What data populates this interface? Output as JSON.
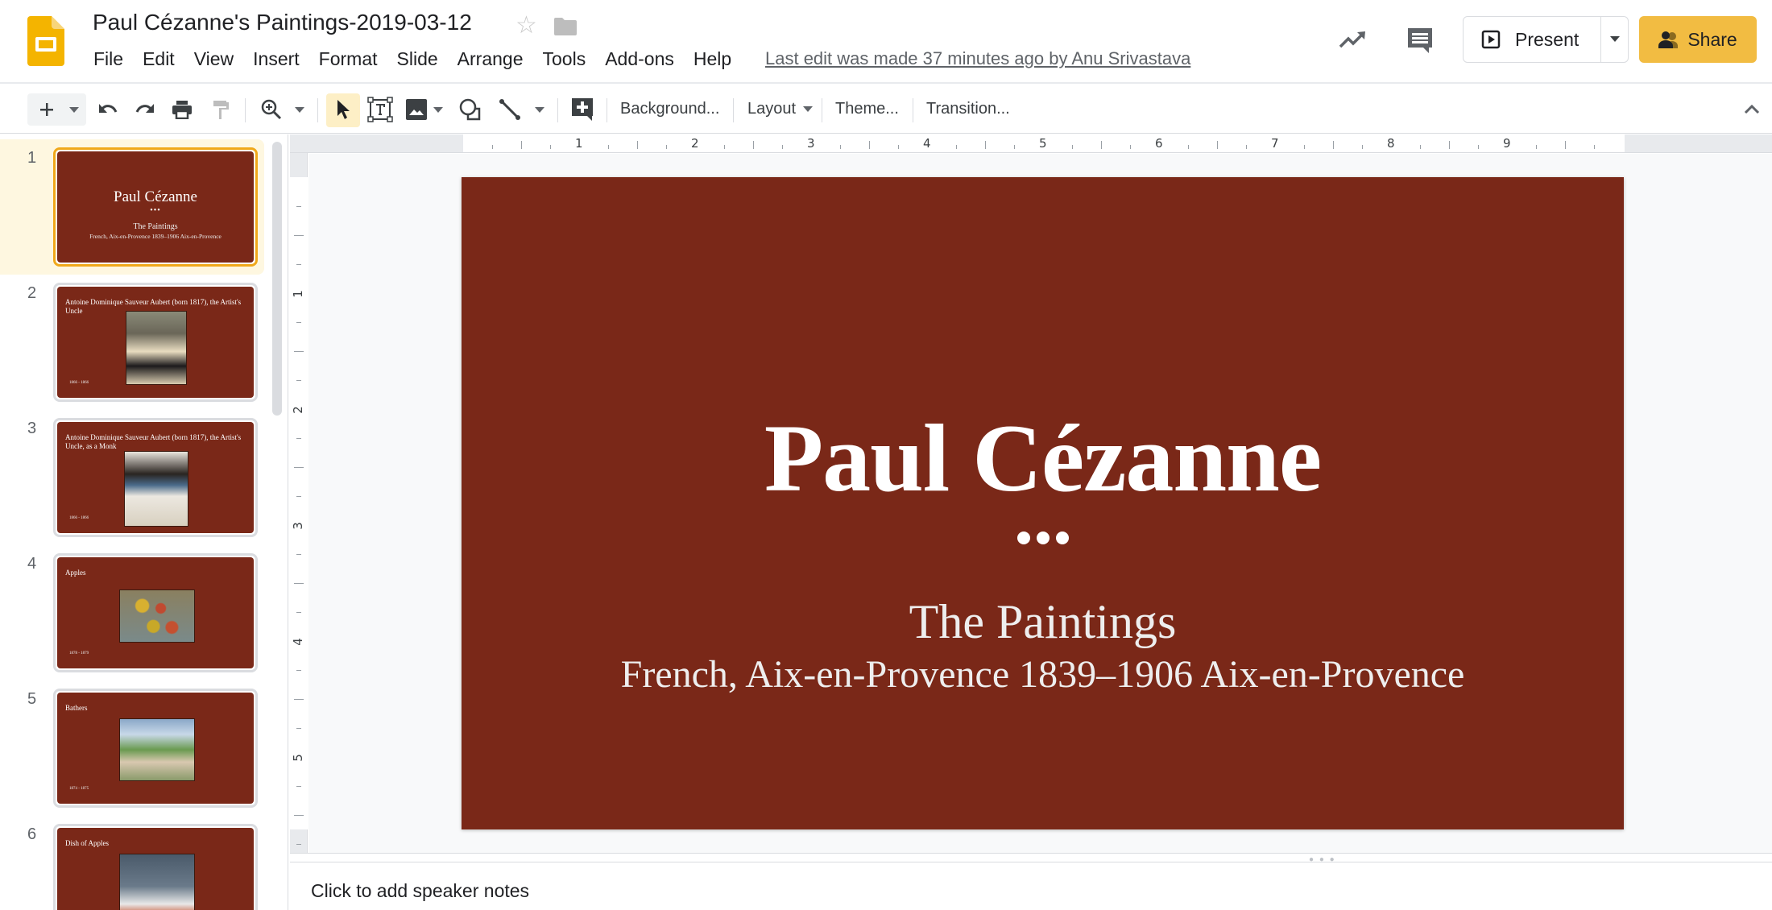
{
  "app": {
    "doc_title": "Paul Cézanne's Paintings-2019-03-12",
    "last_edit": "Last edit was made 37 minutes ago by Anu Srivastava",
    "icons": {
      "logo": "google-slides-logo",
      "star": "star-icon",
      "folder": "folder-icon",
      "activity": "activity-trend-icon",
      "comments": "comments-icon",
      "present": "present-play-icon",
      "share": "share-people-icon"
    }
  },
  "menu": [
    "File",
    "Edit",
    "View",
    "Insert",
    "Format",
    "Slide",
    "Arrange",
    "Tools",
    "Add-ons",
    "Help"
  ],
  "header_buttons": {
    "present": "Present",
    "share": "Share"
  },
  "toolbar": {
    "background": "Background...",
    "layout": "Layout",
    "theme": "Theme...",
    "transition": "Transition..."
  },
  "rulers": {
    "horizontal": [
      "1",
      "2",
      "3",
      "4",
      "5",
      "6",
      "7",
      "8",
      "9"
    ],
    "vertical": [
      "1",
      "2",
      "3",
      "4",
      "5"
    ]
  },
  "slides": [
    {
      "number": "1",
      "title": "Paul Cézanne",
      "subtitle": "The Paintings",
      "subtitle2": "French, Aix-en-Provence 1839–1906 Aix-en-Provence",
      "selected": true
    },
    {
      "number": "2",
      "title": "Antoine Dominique Sauveur Aubert (born 1817), the Artist's Uncle",
      "date": "1866 - 1866",
      "image": "portrait-painting"
    },
    {
      "number": "3",
      "title": "Antoine Dominique Sauveur Aubert (born 1817), the Artist's Uncle, as a Monk",
      "date": "1866 - 1866",
      "image": "monk-portrait-painting"
    },
    {
      "number": "4",
      "title": "Apples",
      "date": "1878 - 1879",
      "image": "apples-still-life-painting"
    },
    {
      "number": "5",
      "title": "Bathers",
      "date": "1874 - 1875",
      "image": "bathers-landscape-painting"
    },
    {
      "number": "6",
      "title": "Dish of Apples",
      "image": "dish-of-apples-painting"
    }
  ],
  "current_slide": {
    "title": "Paul Cézanne",
    "subtitle": "The Paintings",
    "subtitle2": "French, Aix-en-Provence 1839–1906 Aix-en-Provence"
  },
  "notes": {
    "placeholder": "Click to add speaker notes"
  },
  "colors": {
    "slide_background": "#7a2818",
    "accent_yellow": "#f2bc42",
    "selection_border": "#f0a81a",
    "selection_bg": "#fef7e0"
  }
}
